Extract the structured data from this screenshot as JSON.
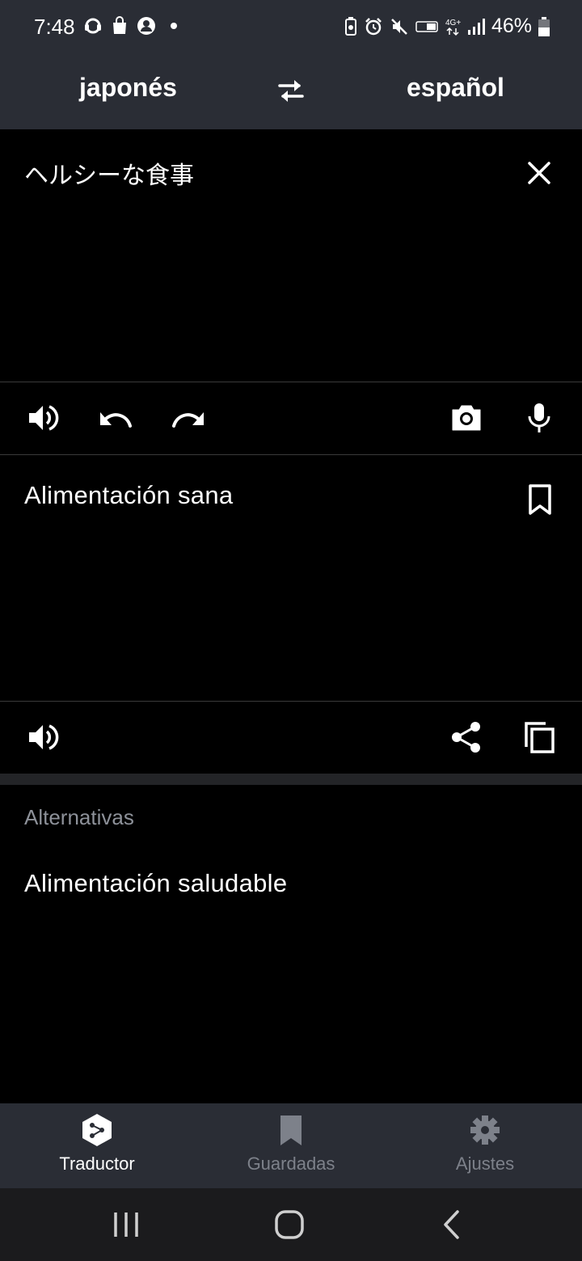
{
  "status_bar": {
    "time": "7:48",
    "battery_percent": "46%",
    "left_icons": [
      "headset-icon",
      "shopping-bag-icon",
      "account-icon",
      "dot-icon"
    ],
    "right_icons": [
      "battery-saver-icon",
      "alarm-icon",
      "mute-icon",
      "volte-icon",
      "4g-icon",
      "signal-icon",
      "battery-icon"
    ]
  },
  "header": {
    "source_language": "japonés",
    "target_language": "español",
    "swap_icon": "swap-arrows-icon"
  },
  "input": {
    "text": "ヘルシーな食事",
    "clear_icon": "close-icon"
  },
  "input_toolbar": {
    "icons": [
      "speaker-icon",
      "undo-icon",
      "redo-icon",
      "camera-icon",
      "microphone-icon"
    ]
  },
  "output": {
    "text": "Alimentación sana",
    "save_icon": "bookmark-icon"
  },
  "output_toolbar": {
    "icons": [
      "speaker-icon",
      "share-icon",
      "copy-icon"
    ]
  },
  "alternatives": {
    "title": "Alternativas",
    "items": [
      "Alimentación saludable"
    ]
  },
  "bottom_nav": {
    "items": [
      {
        "label": "Traductor",
        "icon": "deepl-logo-icon",
        "active": true
      },
      {
        "label": "Guardadas",
        "icon": "bookmark-icon",
        "active": false
      },
      {
        "label": "Ajustes",
        "icon": "gear-icon",
        "active": false
      }
    ]
  },
  "colors": {
    "background": "#000000",
    "bar_background": "#2a2d35",
    "muted_text": "#8d9199",
    "inactive_nav": "#7d818a"
  }
}
